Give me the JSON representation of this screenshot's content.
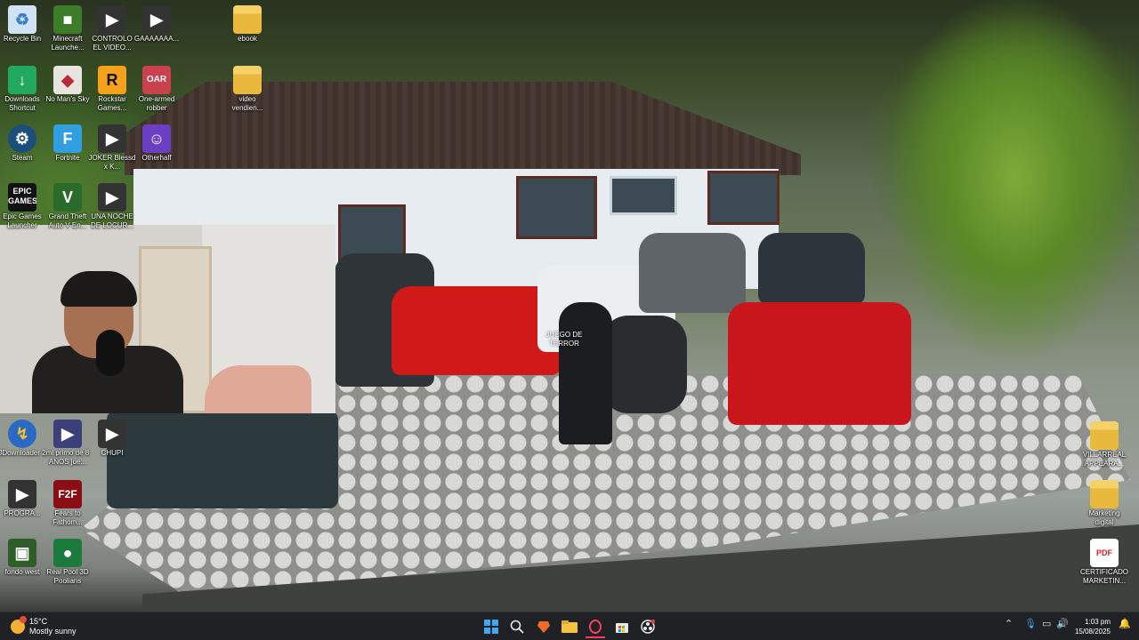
{
  "desktop": {
    "overlay_text": "JUEGO DE TERROR",
    "icons": [
      {
        "label": "Recycle Bin",
        "icon": "recycle-bin-icon",
        "color": "#cfe3f5"
      },
      {
        "label": "Minecraft Launche...",
        "icon": "minecraft-icon",
        "color": "#3d7d2a"
      },
      {
        "label": "CONTROLO EL VIDEO...",
        "icon": "video-file-icon",
        "color": "#333333"
      },
      {
        "label": "GAAAAAAA...",
        "icon": "video-file-icon",
        "color": "#333333"
      },
      {
        "label": "ebook",
        "icon": "folder-icon",
        "color": "#f5c343"
      },
      {
        "label": "Downloads Shortcut",
        "icon": "downloads-icon",
        "color": "#23a860"
      },
      {
        "label": "No Man's Sky",
        "icon": "no-mans-sky-icon",
        "color": "#b82a3a"
      },
      {
        "label": "Rockstar Games...",
        "icon": "rockstar-icon",
        "color": "#f5a11c"
      },
      {
        "label": "One-armed robber",
        "icon": "one-armed-robber-icon",
        "color": "#c8414d"
      },
      {
        "label": "video vendien...",
        "icon": "folder-icon",
        "color": "#f5c343"
      },
      {
        "label": "Steam",
        "icon": "steam-icon",
        "color": "#1b4f7a"
      },
      {
        "label": "Fortnite",
        "icon": "fortnite-icon",
        "color": "#2f9fe0"
      },
      {
        "label": "JOKER Blessd x K...",
        "icon": "video-file-icon",
        "color": "#333333"
      },
      {
        "label": "Otherhalf",
        "icon": "otherhalf-icon",
        "color": "#6a3fc4"
      },
      {
        "label": "Epic Games Launcher",
        "icon": "epic-games-icon",
        "color": "#111111"
      },
      {
        "label": "Grand Theft Auto V En...",
        "icon": "gta-icon",
        "color": "#2a6a2a"
      },
      {
        "label": "UNA NOCHE DE LOCUR...",
        "icon": "video-file-icon",
        "color": "#333333"
      },
      {
        "label": "JDownloader 2",
        "icon": "jdownloader-icon",
        "color": "#f2c12e"
      },
      {
        "label": "mi primo de 8 AÑOS jue...",
        "icon": "video-file-icon",
        "color": "#3b3f7a"
      },
      {
        "label": "CHUPI",
        "icon": "video-file-icon",
        "color": "#333333"
      },
      {
        "label": "PROGRA...",
        "icon": "video-file-icon",
        "color": "#333333"
      },
      {
        "label": "Fears to Fathom...",
        "icon": "fears-to-fathom-icon",
        "color": "#8a0f14"
      },
      {
        "label": "fondo west",
        "icon": "image-file-icon",
        "color": "#2f5d2a"
      },
      {
        "label": "Real Pool 3D Poolians",
        "icon": "real-pool-icon",
        "color": "#1c7a3c"
      },
      {
        "label": "VILLARREAL APPEARA...",
        "icon": "folder-icon",
        "color": "#f5c343"
      },
      {
        "label": "Marketing digital",
        "icon": "folder-icon",
        "color": "#f5c343"
      },
      {
        "label": "CERTIFICADO MARKETIN...",
        "icon": "pdf-icon",
        "color": "#d7261e"
      }
    ]
  },
  "taskbar": {
    "weather_temp": "15°C",
    "weather_desc": "Mostly sunny",
    "apps": [
      {
        "name": "start",
        "icon": "windows-start-icon"
      },
      {
        "name": "search",
        "icon": "search-icon"
      },
      {
        "name": "brave",
        "icon": "brave-browser-icon"
      },
      {
        "name": "file-explorer",
        "icon": "file-explorer-icon"
      },
      {
        "name": "opera",
        "icon": "opera-gx-icon"
      },
      {
        "name": "store",
        "icon": "microsoft-store-icon"
      },
      {
        "name": "obs",
        "icon": "obs-icon"
      }
    ],
    "time": "1:03 pm",
    "date": "15/08/2025"
  }
}
